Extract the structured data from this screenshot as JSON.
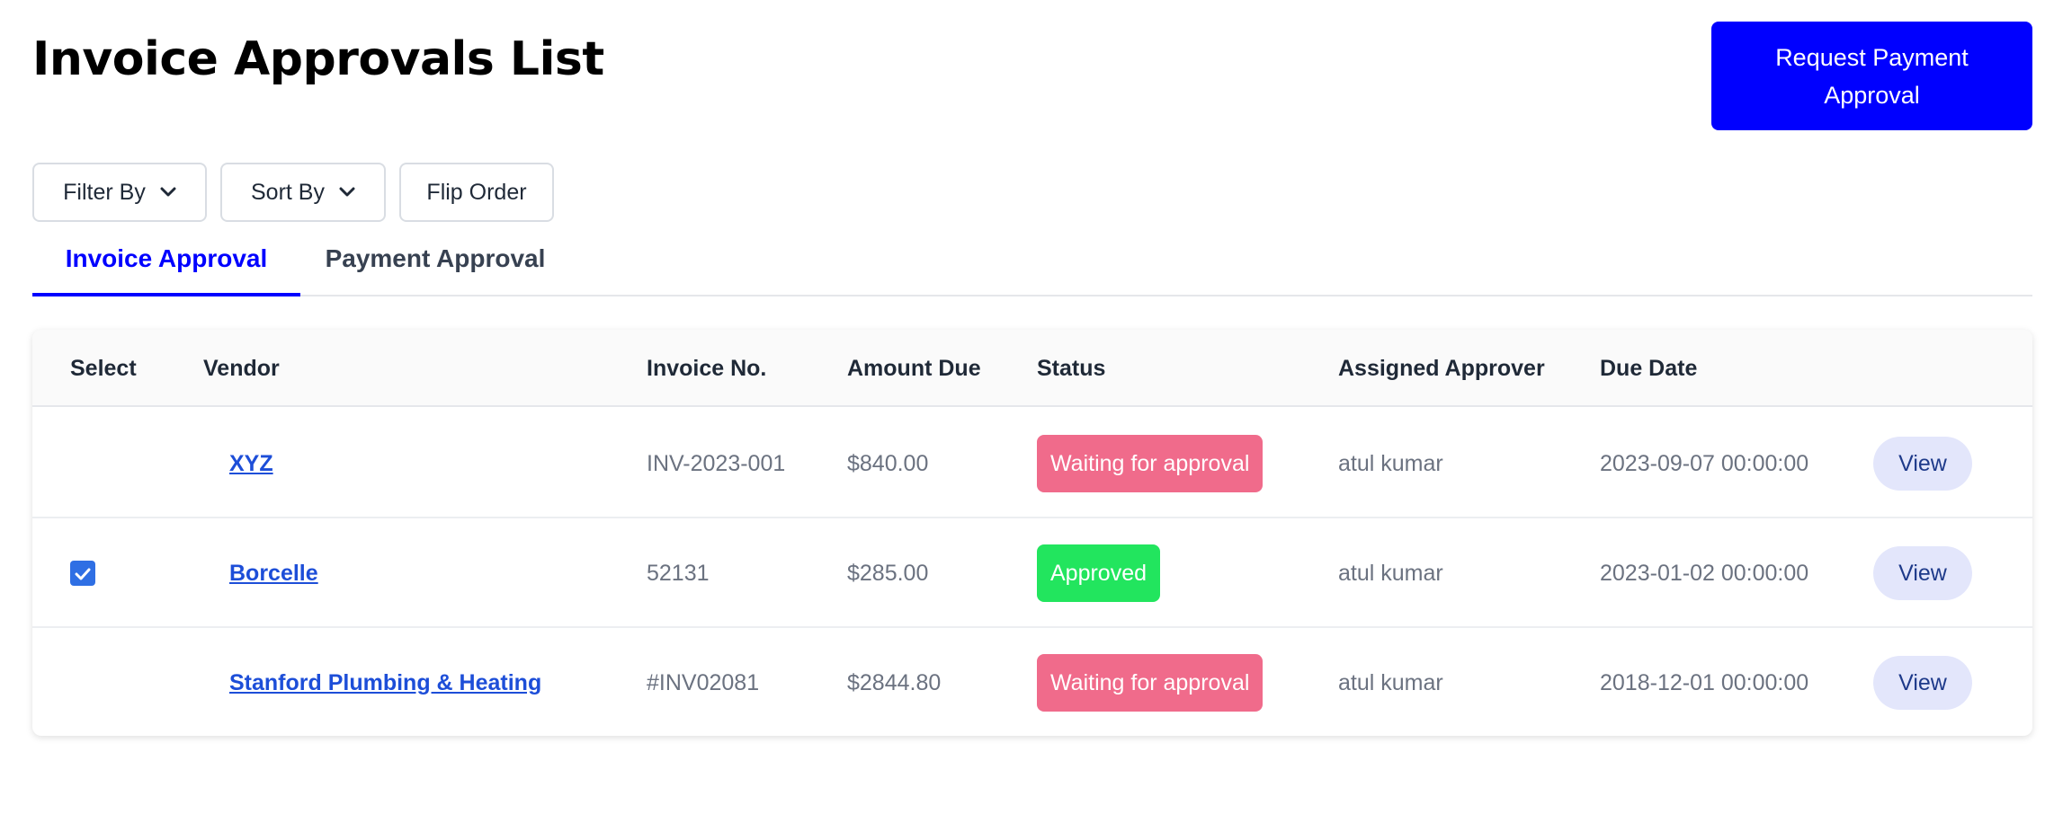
{
  "header": {
    "title": "Invoice Approvals List",
    "primary_button": "Request Payment Approval"
  },
  "controls": {
    "filter_label": "Filter By",
    "sort_label": "Sort By",
    "flip_label": "Flip Order"
  },
  "tabs": [
    {
      "label": "Invoice Approval",
      "active": true
    },
    {
      "label": "Payment Approval",
      "active": false
    }
  ],
  "table": {
    "columns": [
      "Select",
      "Vendor",
      "Invoice No.",
      "Amount Due",
      "Status",
      "Assigned Approver",
      "Due Date"
    ],
    "rows": [
      {
        "selected": false,
        "vendor": "XYZ",
        "invoice_no": "INV-2023-001",
        "amount": "$840.00",
        "status": "Waiting for approval",
        "status_type": "waiting",
        "approver": "atul kumar",
        "due_date": "2023-09-07 00:00:00",
        "action": "View"
      },
      {
        "selected": true,
        "vendor": "Borcelle",
        "invoice_no": "52131",
        "amount": "$285.00",
        "status": "Approved",
        "status_type": "approved",
        "approver": "atul kumar",
        "due_date": "2023-01-02 00:00:00",
        "action": "View"
      },
      {
        "selected": false,
        "vendor": "Stanford Plumbing & Heating",
        "invoice_no": "#INV02081",
        "amount": "$2844.80",
        "status": "Waiting for approval",
        "status_type": "waiting",
        "approver": "atul kumar",
        "due_date": "2018-12-01 00:00:00",
        "action": "View"
      }
    ]
  },
  "colors": {
    "primary": "#0000ff",
    "waiting": "#f06b8b",
    "approved": "#22e55e",
    "link": "#1d4ed8",
    "view_button_bg": "#e3e6fb"
  },
  "icons": {
    "filter_dropdown": "chevron-down-icon",
    "sort_dropdown": "chevron-down-icon",
    "selected_checkbox": "check-icon"
  }
}
